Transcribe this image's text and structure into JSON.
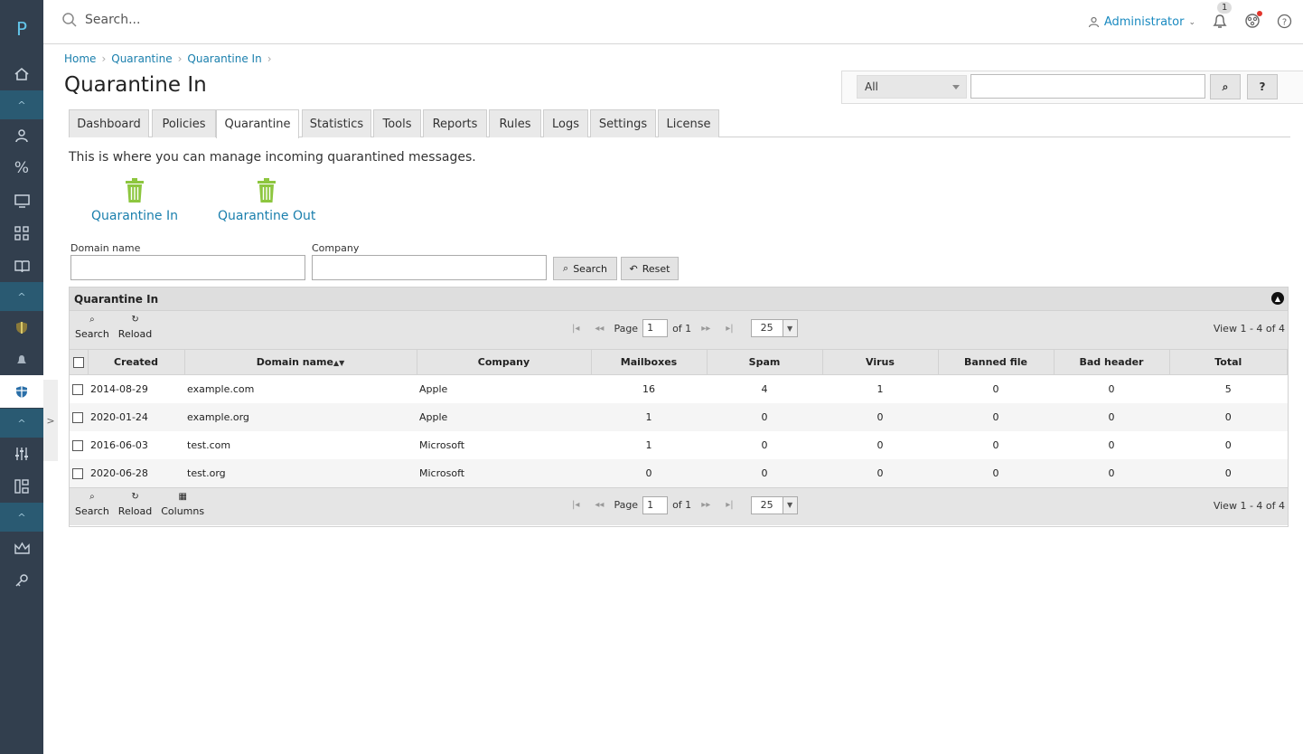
{
  "app": {
    "logo": "P"
  },
  "search": {
    "placeholder": "Search..."
  },
  "user": {
    "name": "Administrator",
    "notifications": "1"
  },
  "breadcrumb": [
    "Home",
    "Quarantine",
    "Quarantine In"
  ],
  "page": {
    "title": "Quarantine In",
    "description": "This is where you can manage incoming quarantined messages."
  },
  "global_search": {
    "scope": "All",
    "search_label": "⌕",
    "help_label": "?"
  },
  "tabs": [
    {
      "label": "Dashboard"
    },
    {
      "label": "Policies"
    },
    {
      "label": "Quarantine"
    },
    {
      "label": "Statistics"
    },
    {
      "label": "Tools"
    },
    {
      "label": "Reports"
    },
    {
      "label": "Rules"
    },
    {
      "label": "Logs"
    },
    {
      "label": "Settings"
    },
    {
      "label": "License"
    }
  ],
  "quick": [
    {
      "label": "Quarantine In"
    },
    {
      "label": "Quarantine Out"
    }
  ],
  "filters": {
    "domain_label": "Domain name",
    "company_label": "Company",
    "search_label": "Search",
    "reset_label": "Reset"
  },
  "grid": {
    "caption": "Quarantine In",
    "pager": {
      "search": "Search",
      "reload": "Reload",
      "columns": "Columns",
      "page_label": "Page",
      "page": "1",
      "of": "of 1",
      "rows": "25",
      "view": "View 1 - 4 of 4"
    },
    "columns": [
      "Created",
      "Domain name",
      "Company",
      "Mailboxes",
      "Spam",
      "Virus",
      "Banned file",
      "Bad header",
      "Total"
    ],
    "rows": [
      [
        "2014-08-29",
        "example.com",
        "Apple",
        "16",
        "4",
        "1",
        "0",
        "0",
        "5"
      ],
      [
        "2020-01-24",
        "example.org",
        "Apple",
        "1",
        "0",
        "0",
        "0",
        "0",
        "0"
      ],
      [
        "2016-06-03",
        "test.com",
        "Microsoft",
        "1",
        "0",
        "0",
        "0",
        "0",
        "0"
      ],
      [
        "2020-06-28",
        "test.org",
        "Microsoft",
        "0",
        "0",
        "0",
        "0",
        "0",
        "0"
      ]
    ]
  },
  "colors": {
    "sidebar": "#323f4e",
    "accent": "#1a7fad",
    "trash": "#8dc63f"
  }
}
